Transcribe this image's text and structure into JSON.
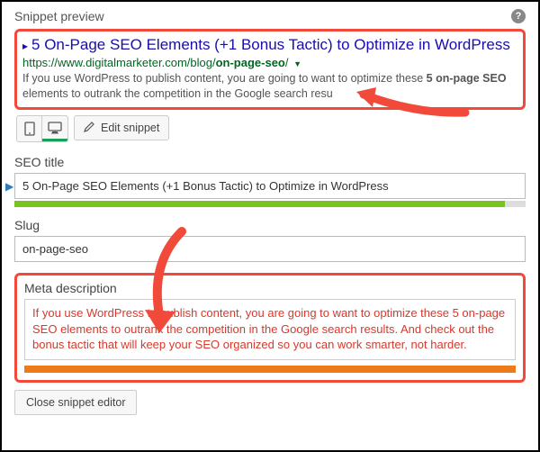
{
  "header": {
    "title": "Snippet preview"
  },
  "preview": {
    "title": "5 On-Page SEO Elements (+1 Bonus Tactic) to Optimize in WordPress",
    "url_prefix": "https://www.digitalmarketer.com/blog/",
    "url_slug": "on-page-seo",
    "url_suffix": "/",
    "desc_before": "If you use WordPress to publish content, you are going to want to optimize these ",
    "desc_bold": "5 on-page SEO",
    "desc_after": " elements to outrank the competition in the Google search resu"
  },
  "toolbar": {
    "edit_label": "Edit snippet"
  },
  "seo_title": {
    "label": "SEO title",
    "value": "5 On-Page SEO Elements (+1 Bonus Tactic) to Optimize in WordPress",
    "progress_pct": 96
  },
  "slug": {
    "label": "Slug",
    "value": "on-page-seo"
  },
  "meta": {
    "label": "Meta description",
    "value": "If you use WordPress to publish content, you are going to want to optimize these 5 on-page SEO elements to outrank the competition in the Google search results. And check out the bonus tactic that will keep your SEO organized so you can work smarter, not harder."
  },
  "footer": {
    "close_label": "Close snippet editor"
  }
}
